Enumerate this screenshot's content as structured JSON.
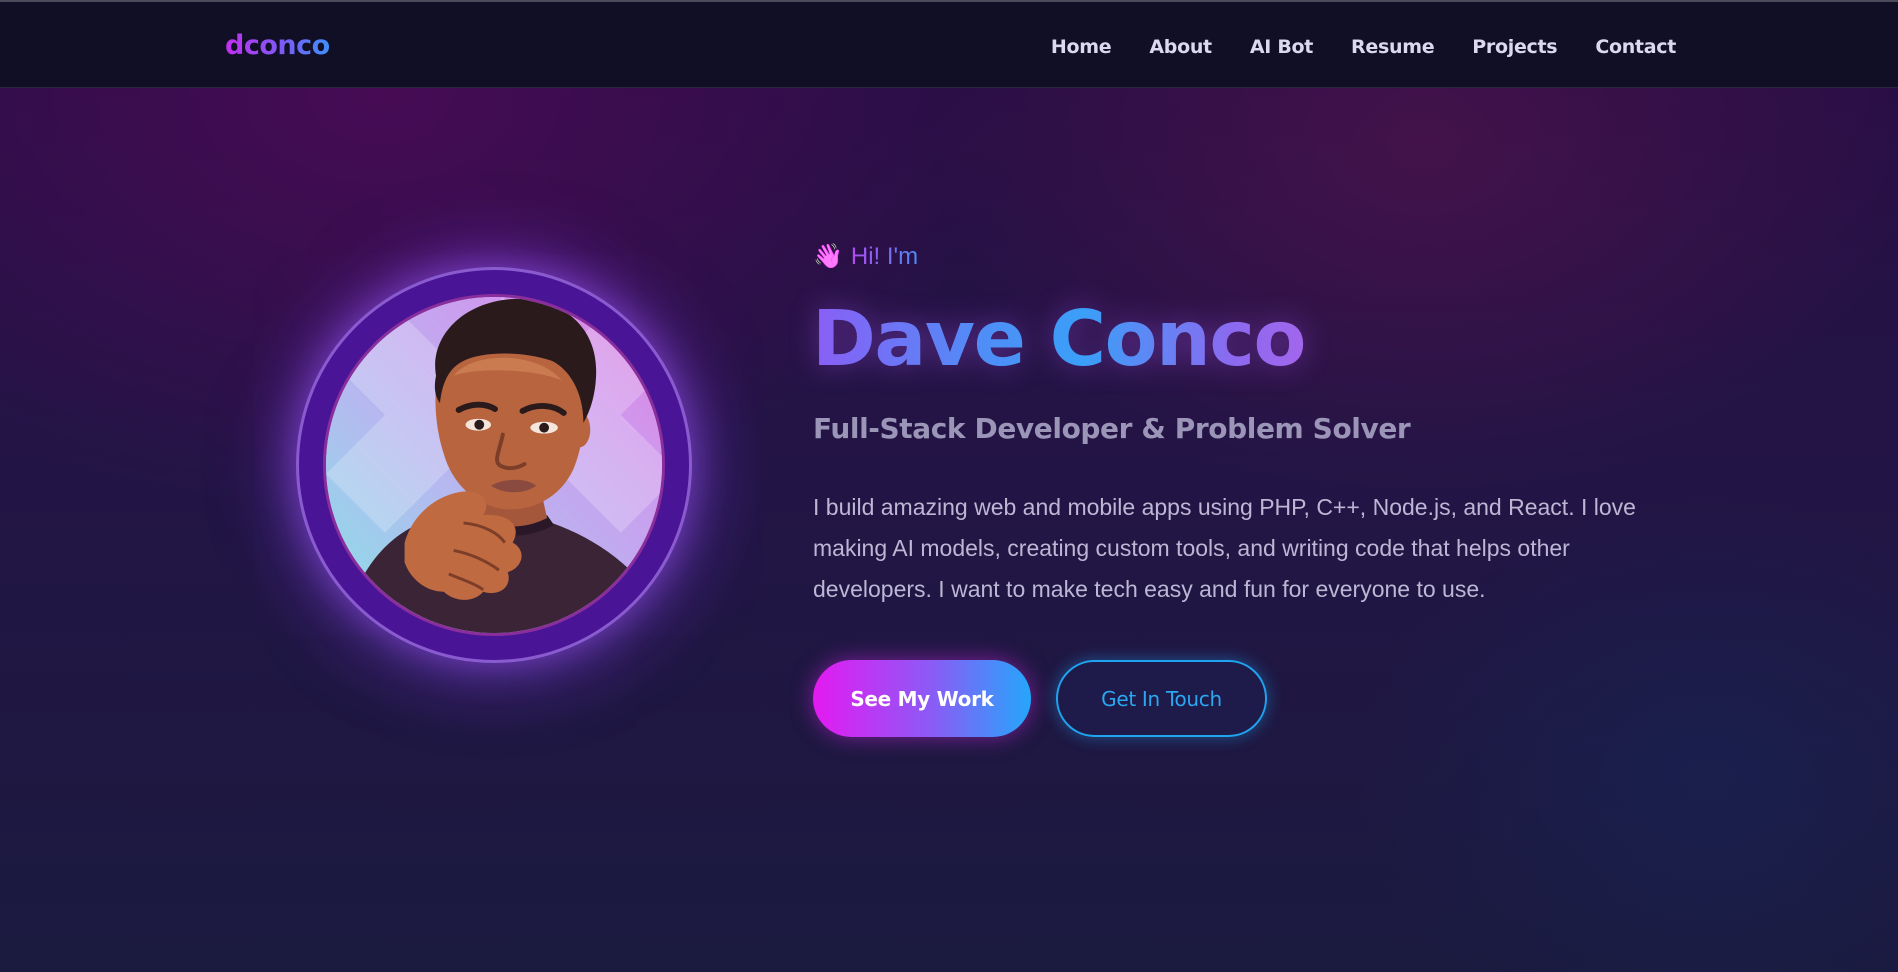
{
  "nav": {
    "logo": "dconco",
    "links": [
      "Home",
      "About",
      "AI Bot",
      "Resume",
      "Projects",
      "Contact"
    ]
  },
  "hero": {
    "greeting_icon": "waving-hand-icon",
    "greeting": "Hi! I'm",
    "name": "Dave Conco",
    "subtitle": "Full-Stack Developer & Problem Solver",
    "description": "I build amazing web and mobile apps using PHP, C++, Node.js, and React. I love making AI models, creating custom tools, and writing code that helps other developers. I want to make tech easy and fun for everyone to use.",
    "primary_button": "See My Work",
    "secondary_button": "Get In Touch"
  },
  "colors": {
    "background": "#1a1638",
    "navbar": "#110f25",
    "accent_pink": "#e41af1",
    "accent_blue": "#25a6fb",
    "accent_purple": "#8a5cf6"
  }
}
